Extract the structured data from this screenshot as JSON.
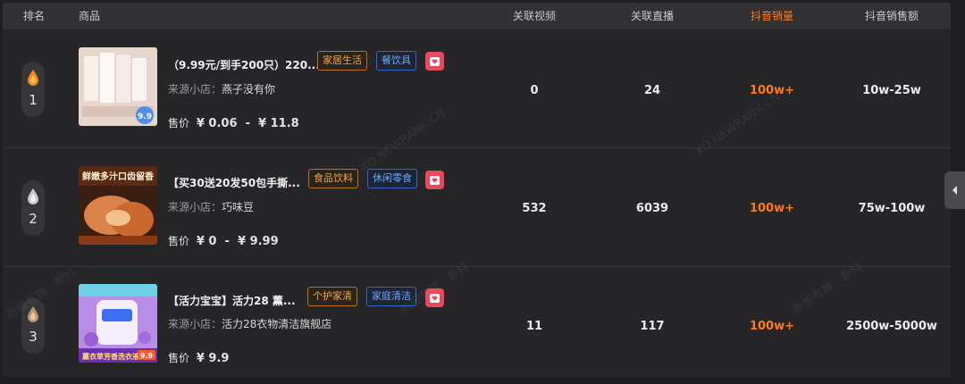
{
  "headers": {
    "rank": "排名",
    "product": "商品",
    "videos": "关联视频",
    "live": "关联直播",
    "douyin_sales": "抖音销量",
    "douyin_revenue": "抖音销售额"
  },
  "labels": {
    "shop_prefix": "来源小店：",
    "price_prefix": "售价",
    "currency": "¥",
    "range_sep": "-"
  },
  "rows": [
    {
      "rank": "1",
      "medal": "gold-drop-icon",
      "title": "（9.99元/到手200只）220...",
      "tag1": "家居生活",
      "tag2": "餐饮具",
      "shop": "燕子没有你",
      "price_low": "0.06",
      "price_high": "11.8",
      "videos": "0",
      "live": "24",
      "sales": "100w+",
      "revenue": "10w-25w",
      "thumb_badge": "9.9"
    },
    {
      "rank": "2",
      "medal": "silver-drop-icon",
      "title": "【买30送20发50包手撕...",
      "tag1": "食品饮料",
      "tag2": "休闲零食",
      "shop": "巧味豆",
      "price_low": "0",
      "price_high": "9.99",
      "videos": "532",
      "live": "6039",
      "sales": "100w+",
      "revenue": "75w-100w",
      "thumb_text": "鲜嫩多汁口齿留香"
    },
    {
      "rank": "3",
      "medal": "bronze-drop-icon",
      "title": "【活力宝宝】活力28 薰...",
      "tag1": "个护家清",
      "tag2": "家庭清洁",
      "shop": "活力28衣物清洁旗舰店",
      "price": "9.9",
      "videos": "11",
      "live": "117",
      "sales": "100w+",
      "revenue": "2500w-5000w",
      "thumb_text": "薰衣草芳香洗衣液",
      "thumb_badge": "9.9"
    }
  ],
  "colors": {
    "accent_orange": "#ff7a1a",
    "tag_orange": "#f0a54a",
    "tag_blue": "#6aa7ff",
    "fav_red": "#e9475e"
  },
  "watermarks": [
    "XD.NEWRANK.CN",
    "新榜有数 · 新抖"
  ]
}
